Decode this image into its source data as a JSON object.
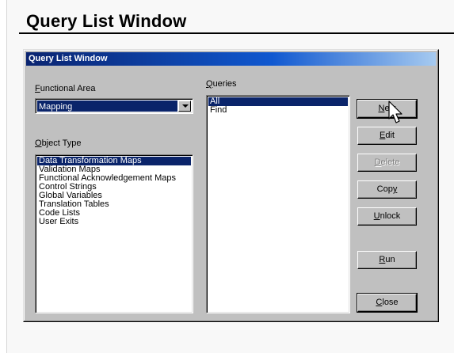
{
  "page": {
    "heading": "Query List Window"
  },
  "window": {
    "title": "Query List Window",
    "functional_area": {
      "label_ul": "F",
      "label_rest": "unctional Area",
      "selected": "Mapping"
    },
    "object_type": {
      "label_ul": "O",
      "label_rest": "bject Type",
      "items": [
        "Data Transformation Maps",
        "Validation Maps",
        "Functional Acknowledgement Maps",
        "Control Strings",
        "Global Variables",
        "Translation Tables",
        "Code Lists",
        "User Exits"
      ],
      "selected_index": 0
    },
    "queries": {
      "label_ul": "Q",
      "label_rest": "ueries",
      "items": [
        "All",
        "Find"
      ],
      "selected_index": 0
    },
    "buttons": {
      "new": {
        "ul": "N",
        "rest": "ew"
      },
      "edit": {
        "ul": "E",
        "rest": "dit"
      },
      "delete": {
        "ul": "D",
        "rest": "elete",
        "enabled": false
      },
      "copy": {
        "pre": "Cop",
        "ul": "y",
        "rest": ""
      },
      "unlock": {
        "ul": "U",
        "rest": "nlock"
      },
      "run": {
        "ul": "R",
        "rest": "un"
      },
      "close": {
        "ul": "C",
        "rest": "lose"
      }
    }
  },
  "colors": {
    "title_bar": "#0a246a",
    "selection": "#0a246a",
    "face": "#c0c0c0"
  }
}
